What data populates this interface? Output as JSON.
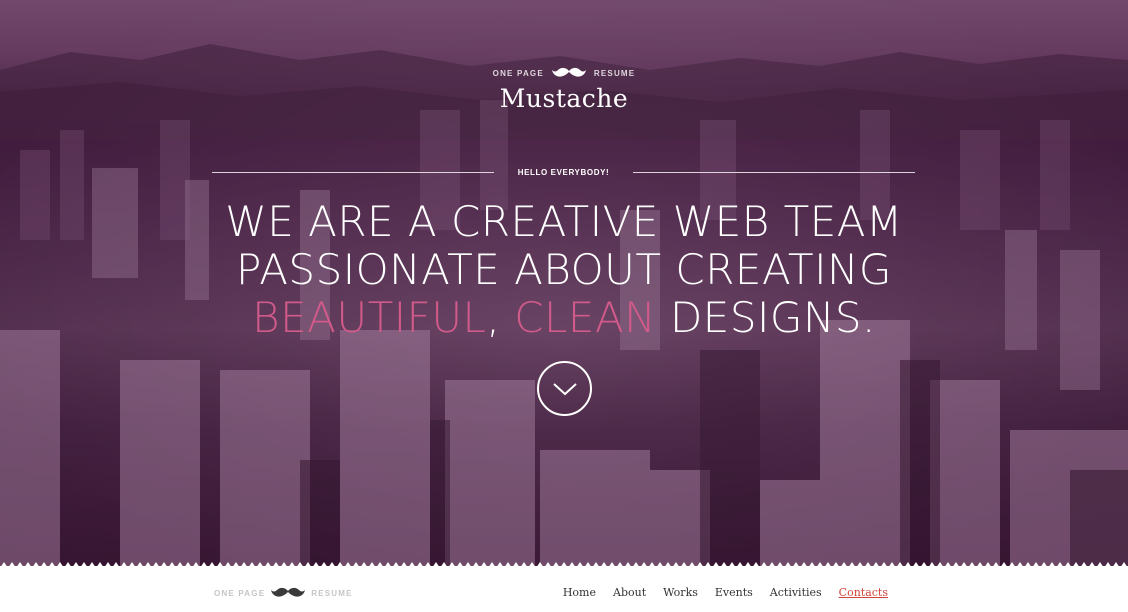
{
  "hero": {
    "brand_top_left": "ONE PAGE",
    "brand_top_right": "RESUME",
    "brand_name": "Mustache",
    "hello": "HELLO EVERYBODY!",
    "headline_line1": "WE ARE A CREATIVE WEB TEAM",
    "headline_line2": "PASSIONATE ABOUT CREATING",
    "headline_word_beautiful": "BEAUTIFUL",
    "headline_comma": ",",
    "headline_word_clean": "CLEAN",
    "headline_word_designs": "DESIGNS.",
    "scroll_icon": "chevron-down-icon",
    "accent_color": "#d05a8a"
  },
  "nav": {
    "brand_left": "ONE PAGE",
    "brand_right": "RESUME",
    "items": [
      {
        "label": "Home"
      },
      {
        "label": "About"
      },
      {
        "label": "Works"
      },
      {
        "label": "Events"
      },
      {
        "label": "Activities"
      },
      {
        "label": "Contacts",
        "active": true
      }
    ],
    "active_color": "#d0453c"
  }
}
